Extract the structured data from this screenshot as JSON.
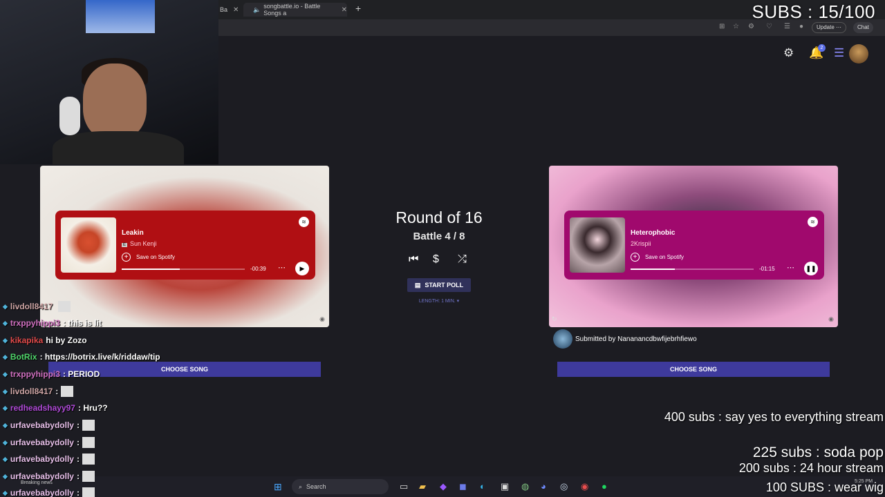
{
  "browser": {
    "tab1_label": "Ba",
    "tab2_label": "songbattle.io - Battle Songs a",
    "new_tab": "+",
    "update_label": "Update",
    "chat_label": "Chat"
  },
  "header": {
    "notification_count": "2"
  },
  "stream_overlay": {
    "subs_counter": "SUBS : 15/100",
    "goals": [
      "400 subs :  say yes to everything stream",
      "225 subs : soda pop",
      "200 subs : 24 hour stream",
      "100 SUBS : wear wig"
    ]
  },
  "battle": {
    "round_title": "Round of 16",
    "battle_counter": "Battle 4 / 8",
    "start_poll_label": "START POLL",
    "length_label": "LENGTH: 1 MIN. ▾"
  },
  "left_song": {
    "title": "Leakin",
    "artist": "Sun Kenji",
    "save_label": "Save on Spotify",
    "time": "-00:39",
    "progress": 0.47,
    "choose_label": "CHOOSE SONG"
  },
  "right_song": {
    "title": "Heterophobic",
    "artist": "2Krispii",
    "save_label": "Save on Spotify",
    "time": "-01:15",
    "progress": 0.36,
    "submitted_by": "Submitted by Nananancdbwfijebrhfiewo",
    "choose_label": "CHOOSE SONG"
  },
  "chat": {
    "messages": [
      {
        "user": "livdoll8417",
        "text": "",
        "color": "#cfa6a6"
      },
      {
        "user": "trxppyhippi3",
        "text": ": this is lit",
        "color": "#d070c0"
      },
      {
        "user": "kikapika",
        "text": "hi by Zozo",
        "color": "#e04a4a"
      },
      {
        "user": "BotRix",
        "text": ": https://botrix.live/k/riddaw/tip",
        "color": "#4fd56a"
      },
      {
        "user": "trxppyhippi3",
        "text": ": PERIOD",
        "color": "#d070c0"
      },
      {
        "user": "livdoll8417",
        "text": ":",
        "color": "#cfa6a6"
      },
      {
        "user": "redheadshayy97",
        "text": ": Hru??",
        "color": "#b04ad8"
      },
      {
        "user": "urfavebabydolly",
        "text": ":",
        "color": "#e8c0ea"
      },
      {
        "user": "urfavebabydolly",
        "text": ":",
        "color": "#e8c0ea"
      },
      {
        "user": "urfavebabydolly",
        "text": ":",
        "color": "#e8c0ea"
      },
      {
        "user": "urfavebabydolly",
        "text": ":",
        "color": "#e8c0ea"
      },
      {
        "user": "urfavebabydolly",
        "text": ":",
        "color": "#e8c0ea"
      }
    ]
  },
  "taskbar": {
    "search_placeholder": "Search",
    "news_label": "Breaking news",
    "clock_time": "5:25 PM"
  },
  "colors": {
    "left_player": "#b00f13",
    "right_player": "#a0096d",
    "choose_button": "#3e3a9c",
    "page_bg": "#1c1c22"
  }
}
